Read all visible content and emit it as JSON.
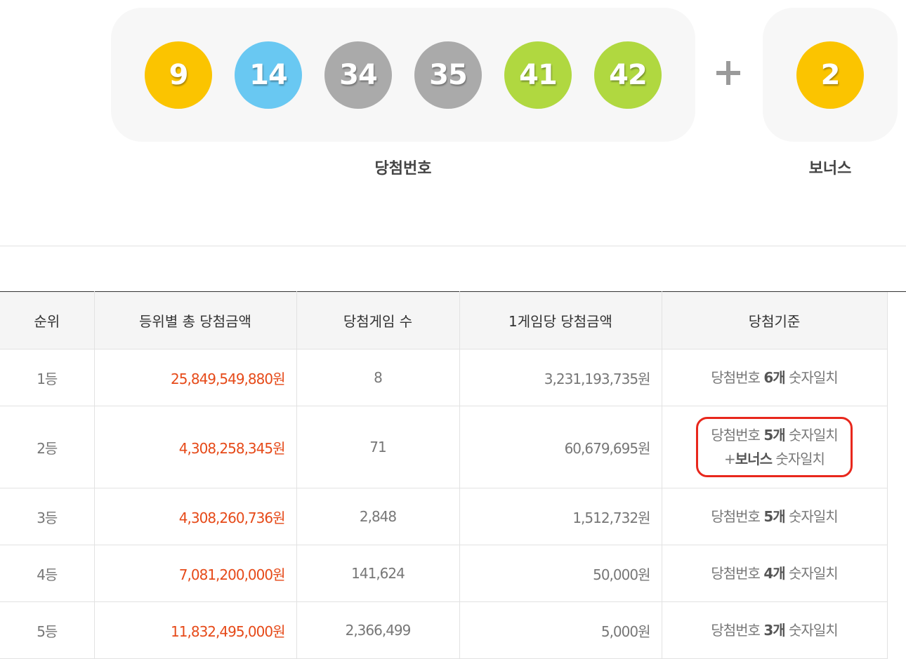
{
  "winning": {
    "balls": [
      {
        "number": "9",
        "color": "#fbc400"
      },
      {
        "number": "14",
        "color": "#69c8f2"
      },
      {
        "number": "34",
        "color": "#aaaaaa"
      },
      {
        "number": "35",
        "color": "#aaaaaa"
      },
      {
        "number": "41",
        "color": "#b0d840"
      },
      {
        "number": "42",
        "color": "#b0d840"
      }
    ],
    "label": "당첨번호"
  },
  "bonus": {
    "number": "2",
    "color": "#fbc400",
    "label": "보너스"
  },
  "table": {
    "headers": [
      "순위",
      "등위별 총 당첨금액",
      "당첨게임 수",
      "1게임당 당첨금액",
      "당첨기준"
    ],
    "rows": [
      {
        "rank": "1등",
        "total": "25,849,549,880원",
        "games": "8",
        "per_game": "3,231,193,735원",
        "crit_pre": "당첨번호 ",
        "crit_bold": "6개",
        "crit_post": " 숫자일치"
      },
      {
        "rank": "2등",
        "total": "4,308,258,345원",
        "games": "71",
        "per_game": "60,679,695원",
        "crit_pre": "당첨번호 ",
        "crit_bold": "5개",
        "crit_post": " 숫자일치",
        "crit2_pre": "+",
        "crit2_bold": "보너스",
        "crit2_post": " 숫자일치"
      },
      {
        "rank": "3등",
        "total": "4,308,260,736원",
        "games": "2,848",
        "per_game": "1,512,732원",
        "crit_pre": "당첨번호 ",
        "crit_bold": "5개",
        "crit_post": " 숫자일치"
      },
      {
        "rank": "4등",
        "total": "7,081,200,000원",
        "games": "141,624",
        "per_game": "50,000원",
        "crit_pre": "당첨번호 ",
        "crit_bold": "4개",
        "crit_post": " 숫자일치"
      },
      {
        "rank": "5등",
        "total": "11,832,495,000원",
        "games": "2,366,499",
        "per_game": "5,000원",
        "crit_pre": "당첨번호 ",
        "crit_bold": "3개",
        "crit_post": " 숫자일치"
      }
    ]
  },
  "colors": {
    "total_amount": "#e64a19",
    "highlight_border": "#e8271c"
  }
}
